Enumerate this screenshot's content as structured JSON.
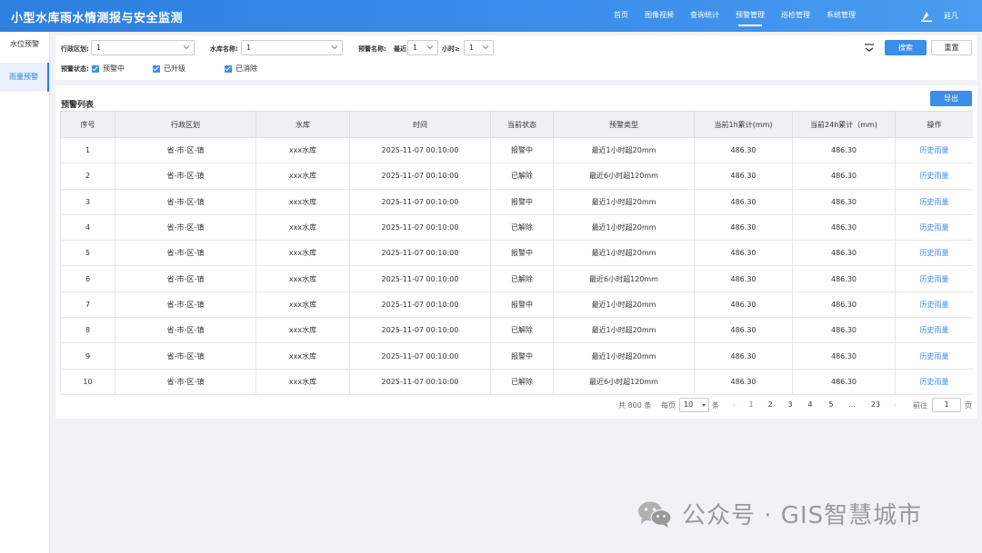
{
  "header": {
    "title": "小型水库雨水情测报与安全监测",
    "nav": [
      {
        "label": "首页",
        "active": false
      },
      {
        "label": "图像视频",
        "active": false
      },
      {
        "label": "查询统计",
        "active": false
      },
      {
        "label": "预警管理",
        "active": true
      },
      {
        "label": "巡检管理",
        "active": false
      },
      {
        "label": "系统管理",
        "active": false
      }
    ],
    "user_name": "延凡"
  },
  "sidebar": {
    "items": [
      {
        "label": "水位预警",
        "active": false
      },
      {
        "label": "雨量预警",
        "active": true
      }
    ]
  },
  "filters": {
    "region_label": "行政区划:",
    "region_value": "1",
    "reservoir_label": "水库名称:",
    "reservoir_value": "1",
    "warning_name_label": "预警名称:",
    "recent_label": "最近",
    "recent_value": "1",
    "hours_label": "小时≥",
    "hours_value": "1",
    "status_label": "预警状态:",
    "status_options": [
      {
        "label": "预警中",
        "checked": true
      },
      {
        "label": "已升级",
        "checked": true
      },
      {
        "label": "已消除",
        "checked": true
      }
    ],
    "search_button": "搜索",
    "reset_button": "重置"
  },
  "list": {
    "title": "预警列表",
    "export_button": "导出",
    "columns": [
      "序号",
      "行政区划",
      "水库",
      "时间",
      "当前状态",
      "预警类型",
      "当前1h累计(mm)",
      "当前24h累计（mm)",
      "操作"
    ],
    "rows": [
      [
        "1",
        "省-市-区-镇",
        "xxx水库",
        "2025-11-07  00:10:00",
        "报警中",
        "最近1小时超20mm",
        "486.30",
        "486.30",
        "历史雨量"
      ],
      [
        "2",
        "省-市-区-镇",
        "xxx水库",
        "2025-11-07  00:10:00",
        "已解除",
        "最近6小时超120mm",
        "486.30",
        "486.30",
        "历史雨量"
      ],
      [
        "3",
        "省-市-区-镇",
        "xxx水库",
        "2025-11-07  00:10:00",
        "报警中",
        "最近1小时超20mm",
        "486.30",
        "486.30",
        "历史雨量"
      ],
      [
        "4",
        "省-市-区-镇",
        "xxx水库",
        "2025-11-07  00:10:00",
        "已解除",
        "最近1小时超20mm",
        "486.30",
        "486.30",
        "历史雨量"
      ],
      [
        "5",
        "省-市-区-镇",
        "xxx水库",
        "2025-11-07  00:10:00",
        "报警中",
        "最近1小时超20mm",
        "486.30",
        "486.30",
        "历史雨量"
      ],
      [
        "6",
        "省-市-区-镇",
        "xxx水库",
        "2025-11-07  00:10:00",
        "已解除",
        "最近6小时超120mm",
        "486.30",
        "486.30",
        "历史雨量"
      ],
      [
        "7",
        "省-市-区-镇",
        "xxx水库",
        "2025-11-07  00:10:00",
        "报警中",
        "最近1小时超20mm",
        "486.30",
        "486.30",
        "历史雨量"
      ],
      [
        "8",
        "省-市-区-镇",
        "xxx水库",
        "2025-11-07  00:10:00",
        "已解除",
        "最近1小时超20mm",
        "486.30",
        "486.30",
        "历史雨量"
      ],
      [
        "9",
        "省-市-区-镇",
        "xxx水库",
        "2025-11-07  00:10:00",
        "报警中",
        "最近1小时超20mm",
        "486.30",
        "486.30",
        "历史雨量"
      ],
      [
        "10",
        "省-市-区-镇",
        "xxx水库",
        "2025-11-07  00:10:00",
        "已解除",
        "最近6小时超120mm",
        "486.30",
        "486.30",
        "历史雨量"
      ]
    ]
  },
  "pagination": {
    "total_text": "共 800 条",
    "per_page_label": "每页",
    "per_page_value": "10",
    "per_page_unit": "条",
    "prev_arrow": "‹",
    "pages": [
      "1",
      "2",
      "3",
      "4",
      "5"
    ],
    "current_page": "1",
    "ellipsis": "…",
    "last_page": "23",
    "next_arrow": "›",
    "goto_label": "前往",
    "goto_value": "1",
    "goto_unit": "页"
  },
  "watermark": {
    "text": "公众号 · GIS智慧城市"
  },
  "colors": {
    "primary": "#3b8eea",
    "header_gradient_start": "#2d7fe0",
    "header_gradient_end": "#4a9cf0",
    "link": "#3b8eea"
  }
}
